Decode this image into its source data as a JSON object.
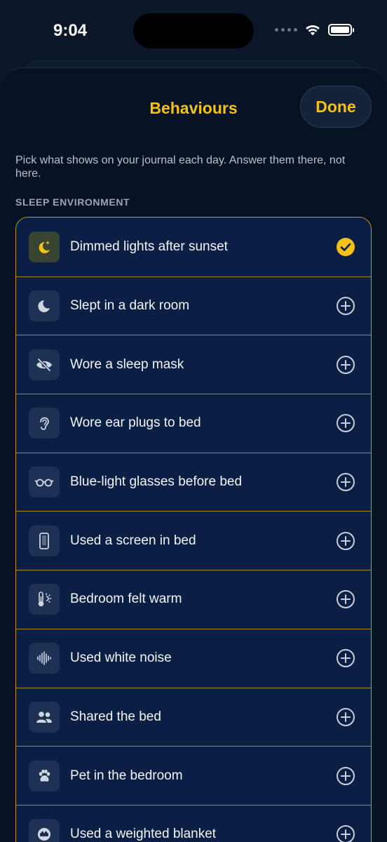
{
  "status": {
    "time": "9:04"
  },
  "header": {
    "title": "Behaviours",
    "done_label": "Done"
  },
  "intro": "Pick what shows on your journal each day. Answer them there, not here.",
  "section": {
    "label": "SLEEP ENVIRONMENT"
  },
  "colors": {
    "accent": "#f4c11b",
    "row_bg": "#0b1f45",
    "divider": "#a8861a"
  },
  "items": [
    {
      "label": "Dimmed lights after sunset",
      "icon": "moon-stars-icon",
      "selected": true
    },
    {
      "label": "Slept in a dark room",
      "icon": "moon-icon",
      "selected": false
    },
    {
      "label": "Wore a sleep mask",
      "icon": "eye-slash-icon",
      "selected": false
    },
    {
      "label": "Wore ear plugs to bed",
      "icon": "ear-icon",
      "selected": false
    },
    {
      "label": "Blue-light glasses before bed",
      "icon": "glasses-icon",
      "selected": false
    },
    {
      "label": "Used a screen in bed",
      "icon": "phone-icon",
      "selected": false
    },
    {
      "label": "Bedroom felt warm",
      "icon": "thermometer-sun-icon",
      "selected": false
    },
    {
      "label": "Used white noise",
      "icon": "waveform-icon",
      "selected": false
    },
    {
      "label": "Shared the bed",
      "icon": "people-icon",
      "selected": false
    },
    {
      "label": "Pet in the bedroom",
      "icon": "paw-icon",
      "selected": false
    },
    {
      "label": "Used a weighted blanket",
      "icon": "bed-icon",
      "selected": false
    }
  ]
}
